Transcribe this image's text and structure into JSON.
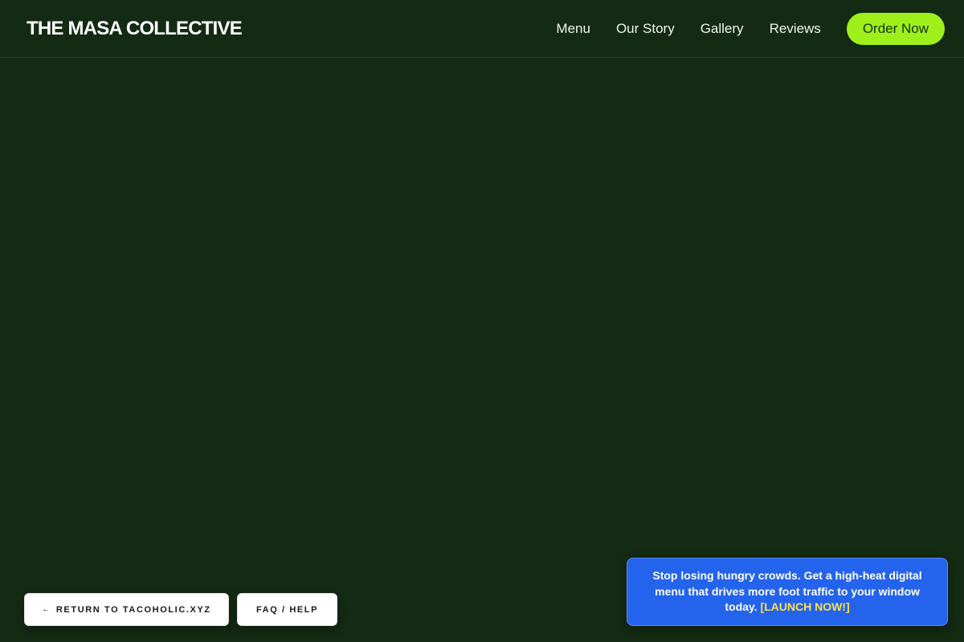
{
  "header": {
    "brand": "THE MASA COLLECTIVE",
    "nav": [
      "Menu",
      "Our Story",
      "Gallery",
      "Reviews"
    ],
    "cta_label": "Order Now"
  },
  "bottom_buttons": {
    "return_arrow": "←",
    "return_label": "RETURN TO TACOHOLIC.XYZ",
    "faq_label": "FAQ / HELP"
  },
  "promo": {
    "text": "Stop losing hungry crowds. Get a high-heat digital menu that drives more foot traffic to your window today. ",
    "link_label": "[LAUNCH NOW!]"
  },
  "colors": {
    "background": "#132a13",
    "accent": "#9ef01a",
    "promo_bg": "#2463eb",
    "promo_link": "#fde047"
  }
}
